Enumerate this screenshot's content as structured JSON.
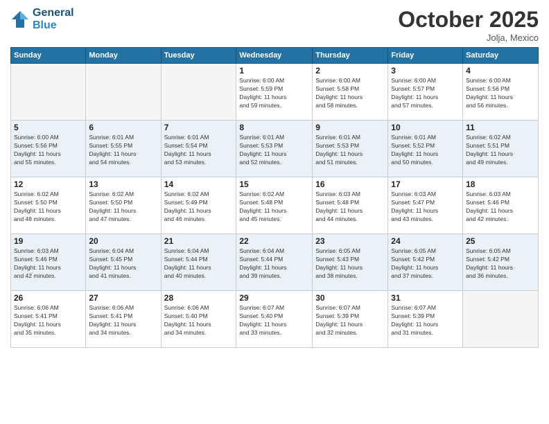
{
  "header": {
    "logo_line1": "General",
    "logo_line2": "Blue",
    "month": "October 2025",
    "location": "Jolja, Mexico"
  },
  "days_of_week": [
    "Sunday",
    "Monday",
    "Tuesday",
    "Wednesday",
    "Thursday",
    "Friday",
    "Saturday"
  ],
  "weeks": [
    [
      {
        "day": "",
        "info": ""
      },
      {
        "day": "",
        "info": ""
      },
      {
        "day": "",
        "info": ""
      },
      {
        "day": "1",
        "info": "Sunrise: 6:00 AM\nSunset: 5:59 PM\nDaylight: 11 hours\nand 59 minutes."
      },
      {
        "day": "2",
        "info": "Sunrise: 6:00 AM\nSunset: 5:58 PM\nDaylight: 11 hours\nand 58 minutes."
      },
      {
        "day": "3",
        "info": "Sunrise: 6:00 AM\nSunset: 5:57 PM\nDaylight: 11 hours\nand 57 minutes."
      },
      {
        "day": "4",
        "info": "Sunrise: 6:00 AM\nSunset: 5:56 PM\nDaylight: 11 hours\nand 56 minutes."
      }
    ],
    [
      {
        "day": "5",
        "info": "Sunrise: 6:00 AM\nSunset: 5:56 PM\nDaylight: 11 hours\nand 55 minutes."
      },
      {
        "day": "6",
        "info": "Sunrise: 6:01 AM\nSunset: 5:55 PM\nDaylight: 11 hours\nand 54 minutes."
      },
      {
        "day": "7",
        "info": "Sunrise: 6:01 AM\nSunset: 5:54 PM\nDaylight: 11 hours\nand 53 minutes."
      },
      {
        "day": "8",
        "info": "Sunrise: 6:01 AM\nSunset: 5:53 PM\nDaylight: 11 hours\nand 52 minutes."
      },
      {
        "day": "9",
        "info": "Sunrise: 6:01 AM\nSunset: 5:53 PM\nDaylight: 11 hours\nand 51 minutes."
      },
      {
        "day": "10",
        "info": "Sunrise: 6:01 AM\nSunset: 5:52 PM\nDaylight: 11 hours\nand 50 minutes."
      },
      {
        "day": "11",
        "info": "Sunrise: 6:02 AM\nSunset: 5:51 PM\nDaylight: 11 hours\nand 49 minutes."
      }
    ],
    [
      {
        "day": "12",
        "info": "Sunrise: 6:02 AM\nSunset: 5:50 PM\nDaylight: 11 hours\nand 48 minutes."
      },
      {
        "day": "13",
        "info": "Sunrise: 6:02 AM\nSunset: 5:50 PM\nDaylight: 11 hours\nand 47 minutes."
      },
      {
        "day": "14",
        "info": "Sunrise: 6:02 AM\nSunset: 5:49 PM\nDaylight: 11 hours\nand 46 minutes."
      },
      {
        "day": "15",
        "info": "Sunrise: 6:02 AM\nSunset: 5:48 PM\nDaylight: 11 hours\nand 45 minutes."
      },
      {
        "day": "16",
        "info": "Sunrise: 6:03 AM\nSunset: 5:48 PM\nDaylight: 11 hours\nand 44 minutes."
      },
      {
        "day": "17",
        "info": "Sunrise: 6:03 AM\nSunset: 5:47 PM\nDaylight: 11 hours\nand 43 minutes."
      },
      {
        "day": "18",
        "info": "Sunrise: 6:03 AM\nSunset: 5:46 PM\nDaylight: 11 hours\nand 42 minutes."
      }
    ],
    [
      {
        "day": "19",
        "info": "Sunrise: 6:03 AM\nSunset: 5:46 PM\nDaylight: 11 hours\nand 42 minutes."
      },
      {
        "day": "20",
        "info": "Sunrise: 6:04 AM\nSunset: 5:45 PM\nDaylight: 11 hours\nand 41 minutes."
      },
      {
        "day": "21",
        "info": "Sunrise: 6:04 AM\nSunset: 5:44 PM\nDaylight: 11 hours\nand 40 minutes."
      },
      {
        "day": "22",
        "info": "Sunrise: 6:04 AM\nSunset: 5:44 PM\nDaylight: 11 hours\nand 39 minutes."
      },
      {
        "day": "23",
        "info": "Sunrise: 6:05 AM\nSunset: 5:43 PM\nDaylight: 11 hours\nand 38 minutes."
      },
      {
        "day": "24",
        "info": "Sunrise: 6:05 AM\nSunset: 5:42 PM\nDaylight: 11 hours\nand 37 minutes."
      },
      {
        "day": "25",
        "info": "Sunrise: 6:05 AM\nSunset: 5:42 PM\nDaylight: 11 hours\nand 36 minutes."
      }
    ],
    [
      {
        "day": "26",
        "info": "Sunrise: 6:06 AM\nSunset: 5:41 PM\nDaylight: 11 hours\nand 35 minutes."
      },
      {
        "day": "27",
        "info": "Sunrise: 6:06 AM\nSunset: 5:41 PM\nDaylight: 11 hours\nand 34 minutes."
      },
      {
        "day": "28",
        "info": "Sunrise: 6:06 AM\nSunset: 5:40 PM\nDaylight: 11 hours\nand 34 minutes."
      },
      {
        "day": "29",
        "info": "Sunrise: 6:07 AM\nSunset: 5:40 PM\nDaylight: 11 hours\nand 33 minutes."
      },
      {
        "day": "30",
        "info": "Sunrise: 6:07 AM\nSunset: 5:39 PM\nDaylight: 11 hours\nand 32 minutes."
      },
      {
        "day": "31",
        "info": "Sunrise: 6:07 AM\nSunset: 5:39 PM\nDaylight: 11 hours\nand 31 minutes."
      },
      {
        "day": "",
        "info": ""
      }
    ]
  ]
}
